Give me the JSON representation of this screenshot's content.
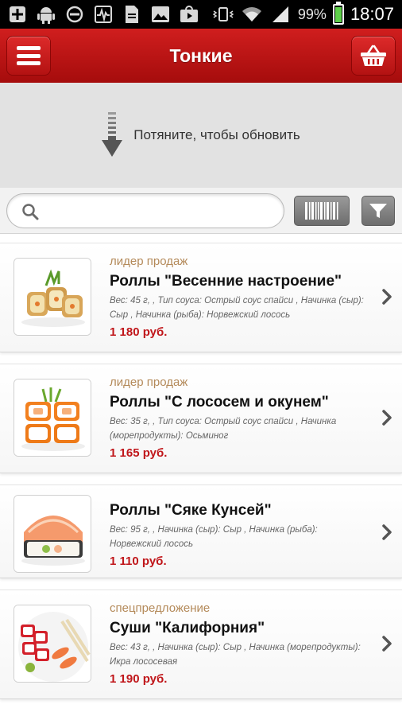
{
  "status_bar": {
    "battery_percent": "99%",
    "time": "18:07"
  },
  "header": {
    "title": "Тонкие"
  },
  "pull_to_refresh": {
    "text": "Потяните, чтобы обновить"
  },
  "search": {
    "placeholder": "",
    "value": ""
  },
  "products": [
    {
      "badge": "лидер продаж",
      "name": "Роллы \"Весенние настроение\"",
      "description": "Вес: 45 г, , Тип соуса: Острый соус спайси , Начинка (сыр): Сыр , Начинка (рыба): Норвежский лосось",
      "price": "1 180 руб."
    },
    {
      "badge": "лидер продаж",
      "name": "Роллы \"С лососем и окунем\"",
      "description": "Вес: 35 г, , Тип соуса: Острый соус спайси , Начинка (морепродукты): Осьминог",
      "price": "1 165 руб."
    },
    {
      "badge": "",
      "name": "Роллы \"Сяке Кунсей\"",
      "description": "Вес: 95 г, , Начинка (сыр): Сыр , Начинка (рыба): Норвежский лосось",
      "price": "1 110 руб."
    },
    {
      "badge": "спецпредложение",
      "name": "Суши \"Калифорния\"",
      "description": "Вес: 43 г, , Начинка (сыр): Сыр , Начинка (морепродукты): Икра лососевая",
      "price": "1 190 руб."
    }
  ],
  "colors": {
    "header_red": "#c21515",
    "price_red": "#c0161a",
    "badge_tan": "#b48a5a"
  }
}
